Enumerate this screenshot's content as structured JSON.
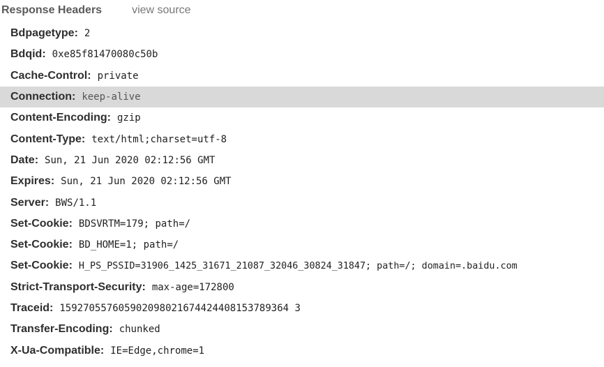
{
  "section": {
    "title": "Response Headers",
    "view_source_label": "view source"
  },
  "headers": [
    {
      "name": "Bdpagetype",
      "value": "2"
    },
    {
      "name": "Bdqid",
      "value": "0xe85f81470080c50b"
    },
    {
      "name": "Cache-Control",
      "value": "private"
    },
    {
      "name": "Connection",
      "value": "keep-alive",
      "selected": true
    },
    {
      "name": "Content-Encoding",
      "value": "gzip"
    },
    {
      "name": "Content-Type",
      "value": "text/html;charset=utf-8"
    },
    {
      "name": "Date",
      "value": "Sun, 21 Jun 2020 02:12:56 GMT"
    },
    {
      "name": "Expires",
      "value": "Sun, 21 Jun 2020 02:12:56 GMT"
    },
    {
      "name": "Server",
      "value": "BWS/1.1"
    },
    {
      "name": "Set-Cookie",
      "value": "BDSVRTM=179; path=/"
    },
    {
      "name": "Set-Cookie",
      "value": "BD_HOME=1; path=/"
    },
    {
      "name": "Set-Cookie",
      "value": "H_PS_PSSID=31906_1425_31671_21087_32046_30824_31847; path=/; domain=.baidu.com"
    },
    {
      "name": "Strict-Transport-Security",
      "value": "max-age=172800"
    },
    {
      "name": "Traceid",
      "value": "159270557605902098021674424408153789364 3"
    },
    {
      "name": "Transfer-Encoding",
      "value": "chunked"
    },
    {
      "name": "X-Ua-Compatible",
      "value": "IE=Edge,chrome=1"
    }
  ],
  "colors": {
    "selected_row_bg": "#d9d9d9",
    "title_text": "#5a5a5a",
    "link_text": "#777777"
  }
}
